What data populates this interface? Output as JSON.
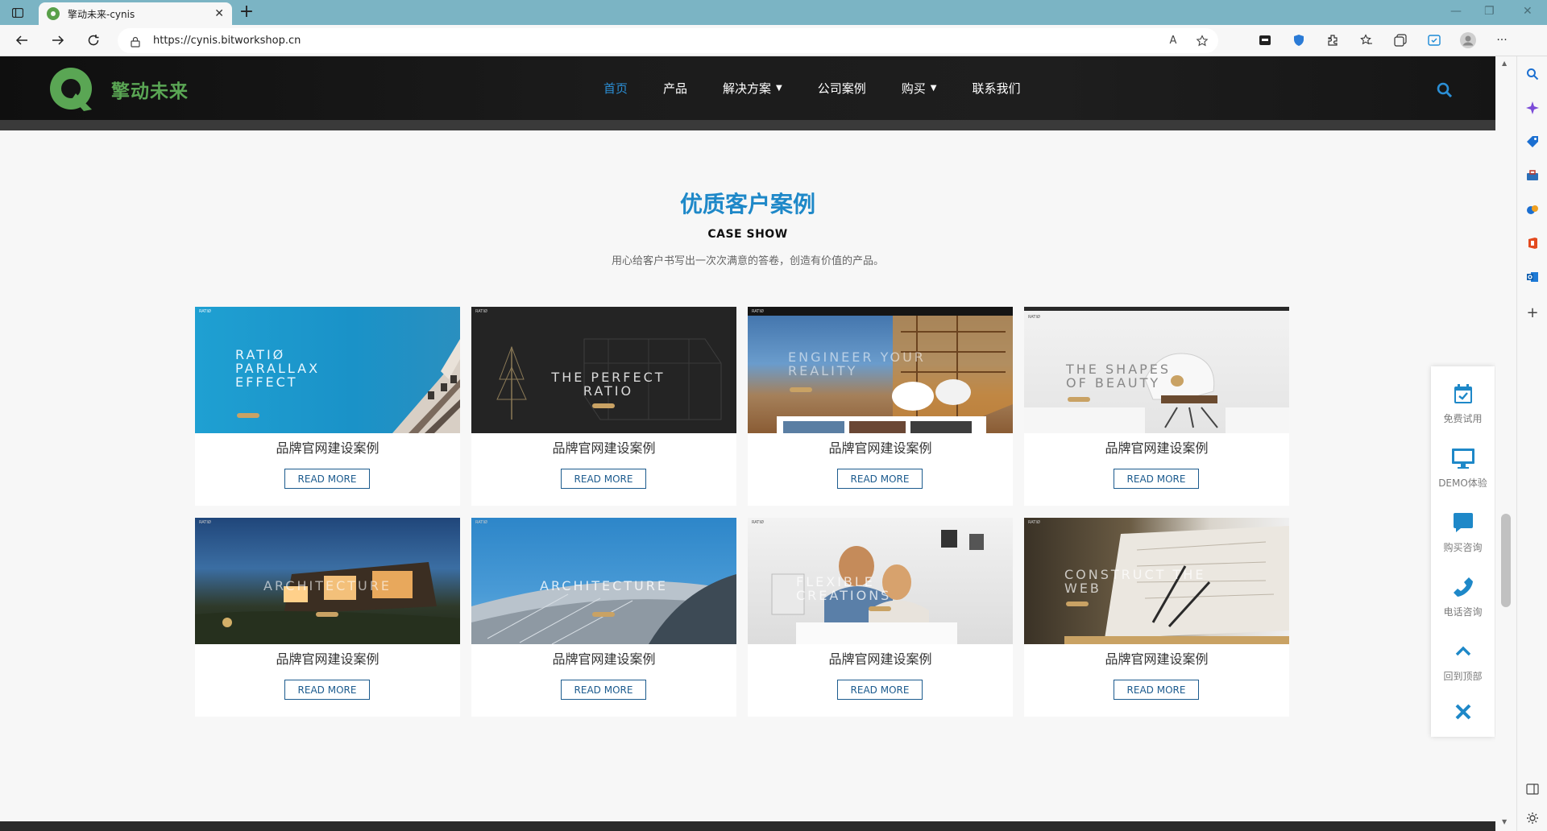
{
  "browser": {
    "tab_title": "擎动未来-cynis",
    "url": "https://cynis.bitworkshop.cn",
    "read_aloud_label": "A",
    "icons": [
      "back-icon",
      "forward-icon",
      "refresh-icon",
      "lock-icon",
      "read-aloud-icon",
      "add-favorite-icon",
      "collections-icon",
      "extensions-icon",
      "favorites-icon",
      "profile-icon",
      "more-icon"
    ]
  },
  "site": {
    "logo_text": "擎动未来",
    "nav": [
      {
        "label": "首页",
        "active": true,
        "dropdown": false
      },
      {
        "label": "产品",
        "active": false,
        "dropdown": false
      },
      {
        "label": "解决方案",
        "active": false,
        "dropdown": true
      },
      {
        "label": "公司案例",
        "active": false,
        "dropdown": false
      },
      {
        "label": "购买",
        "active": false,
        "dropdown": true
      },
      {
        "label": "联系我们",
        "active": false,
        "dropdown": false
      }
    ],
    "accent_color": "#2b8fd6",
    "brand_color": "#5aa654"
  },
  "section": {
    "title": "优质客户案例",
    "subtitle": "CASE SHOW",
    "description": "用心给客户书写出一次次满意的答卷，创造有价值的产品。"
  },
  "cards": [
    {
      "title": "品牌官网建设案例",
      "button": "READ MORE",
      "hero": "RATIØ PARALLAX EFFECT",
      "tag": "RATIØ"
    },
    {
      "title": "品牌官网建设案例",
      "button": "READ MORE",
      "hero": "THE PERFECT RATIO",
      "tag": "RATIØ"
    },
    {
      "title": "品牌官网建设案例",
      "button": "READ MORE",
      "hero": "ENGINEER YOUR REALITY",
      "tag": "RATIØ"
    },
    {
      "title": "品牌官网建设案例",
      "button": "READ MORE",
      "hero": "THE SHAPES OF BEAUTY",
      "tag": "RATIØ"
    },
    {
      "title": "品牌官网建设案例",
      "button": "READ MORE",
      "hero": "ARCHITECTURE",
      "tag": "RATIØ"
    },
    {
      "title": "品牌官网建设案例",
      "button": "READ MORE",
      "hero": "ARCHITECTURE",
      "tag": "RATIØ"
    },
    {
      "title": "品牌官网建设案例",
      "button": "READ MORE",
      "hero": "FLEXIBLE CREATIONS",
      "tag": "RATIØ"
    },
    {
      "title": "品牌官网建设案例",
      "button": "READ MORE",
      "hero": "CONSTRUCT THE WEB",
      "tag": "RATIØ"
    }
  ],
  "float_panel": [
    {
      "label": "免费试用",
      "icon": "calendar-check-icon"
    },
    {
      "label": "DEMO体验",
      "icon": "monitor-icon"
    },
    {
      "label": "购买咨询",
      "icon": "chat-bubble-icon"
    },
    {
      "label": "电话咨询",
      "icon": "phone-icon"
    },
    {
      "label": "回到顶部",
      "icon": "chevron-up-icon"
    },
    {
      "label": "",
      "icon": "close-icon"
    }
  ],
  "float_color": "#1e88c8"
}
